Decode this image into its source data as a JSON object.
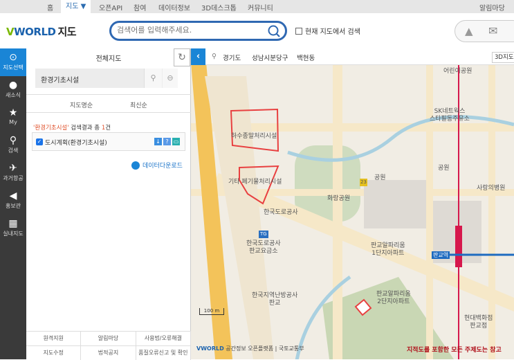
{
  "topnav": {
    "items": [
      "홈",
      "지도 ▼",
      "오픈API",
      "참여",
      "데이터정보",
      "3D데스크톱",
      "커뮤니티"
    ],
    "right": "알림마당"
  },
  "header": {
    "logo_v": "V",
    "logo_world": "WORLD",
    "logo_map": "지도",
    "search_placeholder": "검색어를 입력해주세요.",
    "current_map_search": "현재 지도에서 검색"
  },
  "rail": {
    "items": [
      {
        "label": "지도선택",
        "icon": "map-pin-icon",
        "active": true
      },
      {
        "label": "새소식",
        "icon": "microphone-icon"
      },
      {
        "label": "My",
        "icon": "star-icon"
      },
      {
        "label": "검색",
        "icon": "search-icon"
      },
      {
        "label": "과거항공",
        "icon": "airplane-icon"
      },
      {
        "label": "홍보관",
        "icon": "megaphone-icon"
      },
      {
        "label": "실내지도",
        "icon": "indoor-grid-icon"
      }
    ]
  },
  "panel": {
    "title": "전체지도",
    "search_value": "환경기초시설",
    "sort": [
      "지도명순",
      "최신순"
    ],
    "result_keyword": "'환경기초시설'",
    "result_text": " 검색결과 총 ",
    "result_count": "1",
    "result_unit": "건",
    "item_label": "도시계획(환경기초시설)",
    "item_checked": true,
    "download": "데이터다운로드",
    "footer": [
      [
        "원격지원",
        "알림마당",
        "사용법/오류해결"
      ],
      [
        "지도수정",
        "법적공지",
        "품질오류신고 및 확인"
      ]
    ]
  },
  "map": {
    "breadcrumb": [
      "경기도",
      "성남시분당구",
      "백현동"
    ],
    "btn_3d": "3D지도",
    "labels": {
      "sewage": "하수종말처리시설",
      "waste": "기타 폐기물처리시설",
      "expressway_corp": "한국도로공사",
      "tollgate": "한국도로공사\n판교요금소",
      "hwarang": "화랑공원",
      "park1": "공원",
      "park2": "공원",
      "road23": "23",
      "kids_park": "어린이공원",
      "sk": "SK네트웍스\n스타필동주유소",
      "hospital": "사랑의병원",
      "apt1": "판교알파리움\n1단지아파트",
      "apt2": "판교알파리움\n2단지아파트",
      "station": "판교역",
      "hyundai": "현대백화점\n판교점",
      "lh": "한국지역난방공사\n판교",
      "tg": "TG"
    },
    "scale": "100 m",
    "attribution": "공간정보 오픈플랫폼 | 국토교통부",
    "warning": "지적도를 포함한 모든 주제도는 참고"
  },
  "colors": {
    "accent": "#1a85d6",
    "rail": "#3a3a3a",
    "subway": "#d6174c",
    "highlight": "#e0502a"
  }
}
